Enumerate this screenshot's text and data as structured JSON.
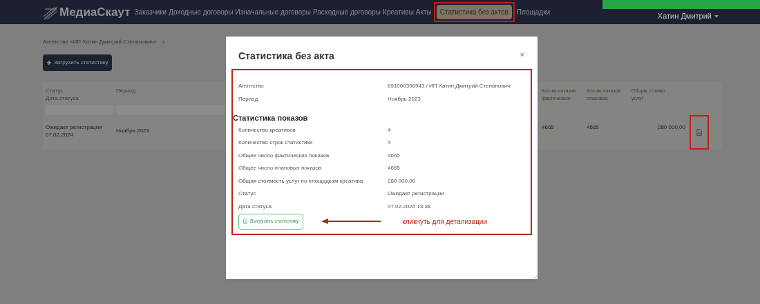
{
  "nav": {
    "logo": "МедиаСкаут",
    "items": [
      {
        "label": "Заказчики",
        "selected": false
      },
      {
        "label": "Доходные договоры",
        "selected": false
      },
      {
        "label": "Изначальные договоры",
        "selected": false
      },
      {
        "label": "Расходные договоры",
        "selected": false
      },
      {
        "label": "Креативы",
        "selected": false
      },
      {
        "label": "Акты",
        "selected": false
      },
      {
        "label": "Статистика без актов",
        "selected": true
      },
      {
        "label": "Площадки",
        "selected": false
      }
    ],
    "user": "Хатин Дмитрий"
  },
  "breadcrumb": "Агентство «ИП Хатин Дмитрий Степанович»",
  "breadcrumb_separator": "›",
  "upload_button": "Загрузить статистику",
  "table": {
    "left_columns": [
      [
        "Статус",
        "Дата статуса"
      ],
      [
        "Период"
      ]
    ],
    "right_columns": [
      [
        "Кол-во показов",
        "фактическое"
      ],
      [
        "Кол-во показов",
        "плановое"
      ],
      [
        "Общая стоимо...",
        "услуг"
      ]
    ],
    "row": {
      "status": "Ожидает регистрации",
      "status_date": "07.02.2024",
      "period": "Ноябрь 2023",
      "actual": "4665",
      "planned": "4665",
      "cost": "280 000,00"
    }
  },
  "modal": {
    "title": "Статистика без акта",
    "close": "×",
    "fields": [
      {
        "label": "Агентство",
        "value": "691000396943 / ИП Хатин Дмитрий Степанович"
      },
      {
        "label": "Период",
        "value": "Ноябрь 2023"
      }
    ],
    "section": "Статистика показов",
    "stats": [
      {
        "label": "Количество креативов",
        "value": "4"
      },
      {
        "label": "Количество строк статистики",
        "value": "4"
      },
      {
        "label": "Общее число фактических показов",
        "value": "4665"
      },
      {
        "label": "Общее число плановых показов",
        "value": "4665"
      },
      {
        "label": "Общая стоимость услуг по площадкам креатива",
        "value": "280 000,00"
      },
      {
        "label": "Статус",
        "value": "Ожидает регистрации"
      },
      {
        "label": "Дата статуса",
        "value": "07.02.2024 13:38"
      }
    ],
    "export_button": "Выгрузить статистику",
    "annotation": "кликнуть для детализации"
  }
}
